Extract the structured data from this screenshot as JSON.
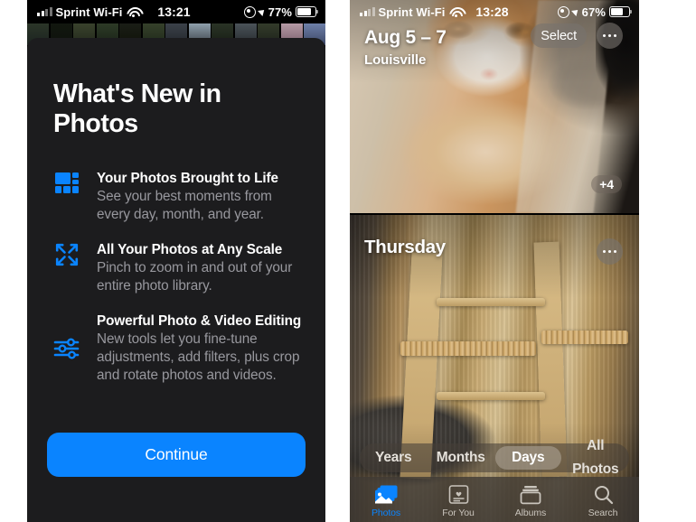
{
  "left_phone": {
    "status_bar": {
      "carrier": "Sprint Wi-Fi",
      "wifi_icon": "wifi-icon",
      "time": "13:21",
      "lock_icon": "rotation-lock-icon",
      "location_icon": "location-arrow-icon",
      "battery_percent": "77%",
      "battery_icon": "battery-icon"
    },
    "sheet": {
      "title": "What's New in Photos",
      "features": [
        {
          "icon": "photo-grid-icon",
          "title": "Your Photos Brought to Life",
          "desc": "See your best moments from every day, month, and year."
        },
        {
          "icon": "expand-arrows-icon",
          "title": "All Your Photos at Any Scale",
          "desc": "Pinch to zoom in and out of your entire photo library."
        },
        {
          "icon": "sliders-icon",
          "title": "Powerful Photo & Video Editing",
          "desc": "New tools let you fine-tune adjustments, add filters, plus crop and rotate photos and videos."
        }
      ],
      "continue_label": "Continue"
    }
  },
  "right_phone": {
    "status_bar": {
      "carrier": "Sprint Wi-Fi",
      "wifi_icon": "wifi-icon",
      "time": "13:28",
      "lock_icon": "rotation-lock-icon",
      "location_icon": "location-arrow-icon",
      "battery_percent": "67%",
      "battery_icon": "battery-icon"
    },
    "cards": [
      {
        "date": "Aug 5 – 7",
        "place": "Louisville",
        "select_label": "Select",
        "more_icon": "ellipsis-icon",
        "extra_count": "+4"
      },
      {
        "title": "Thursday",
        "more_icon": "ellipsis-icon"
      }
    ],
    "scale_control": {
      "options": [
        "Years",
        "Months",
        "Days",
        "All Photos"
      ],
      "selected": "Days"
    },
    "tabs": [
      {
        "label": "Photos",
        "icon": "photos-icon",
        "active": true
      },
      {
        "label": "For You",
        "icon": "heart-card-icon",
        "active": false
      },
      {
        "label": "Albums",
        "icon": "albums-icon",
        "active": false
      },
      {
        "label": "Search",
        "icon": "search-icon",
        "active": false
      }
    ]
  },
  "colors": {
    "accent_blue": "#0a84ff",
    "sheet_bg": "#1c1c1e",
    "secondary_text": "#98989e"
  }
}
